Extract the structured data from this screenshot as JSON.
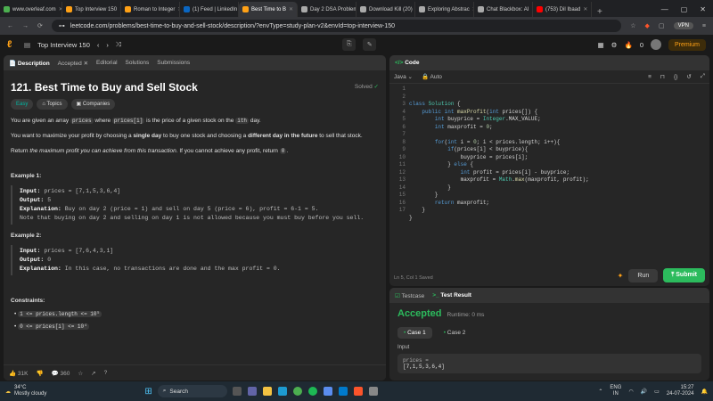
{
  "browser": {
    "tabs": [
      {
        "label": "www.overleaf.com",
        "color": "#4caf50"
      },
      {
        "label": "Top Interview 150",
        "color": "#ffa116"
      },
      {
        "label": "Roman to Integer",
        "color": "#ffa116"
      },
      {
        "label": "(1) Feed | LinkedIn",
        "color": "#0a66c2"
      },
      {
        "label": "Best Time to B",
        "color": "#ffa116",
        "active": true
      },
      {
        "label": "Day 2 DSA Problem",
        "color": "#aaaaaa"
      },
      {
        "label": "Download Kill (20)",
        "color": "#aaaaaa"
      },
      {
        "label": "Exploring Abstrac",
        "color": "#aaaaaa"
      },
      {
        "label": "Chat Blackbox: AI",
        "color": "#aaaaaa"
      },
      {
        "label": "(753) Dil Ibaad",
        "color": "#ff0000"
      }
    ],
    "url": "leetcode.com/problems/best-time-to-buy-and-sell-stock/description/?envType=study-plan-v2&envId=top-interview-150",
    "vpn": "VPN"
  },
  "lcnav": {
    "list_title": "Top Interview 150",
    "coins": "0",
    "premium": "Premium"
  },
  "left_tabs": [
    "Description",
    "Accepted",
    "Editorial",
    "Solutions",
    "Submissions"
  ],
  "problem": {
    "title": "121. Best Time to Buy and Sell Stock",
    "solved": "Solved",
    "difficulty": "Easy",
    "topics": "Topics",
    "companies": "Companies",
    "p1_a": "You are given an array ",
    "p1_code1": "prices",
    "p1_b": " where ",
    "p1_code2": "prices[i]",
    "p1_c": " is the price of a given stock on the ",
    "p1_sup": "ith",
    "p1_d": " day.",
    "p2_a": "You want to maximize your profit by choosing a ",
    "p2_b1": "single day",
    "p2_c": " to buy one stock and choosing a ",
    "p2_b2": "different day in the future",
    "p2_d": " to sell that stock.",
    "p3_a": "Return ",
    "p3_i": "the maximum profit you can achieve from this transaction",
    "p3_b": ". If you cannot achieve any profit, return ",
    "p3_code": "0",
    "p3_c": ".",
    "ex1_head": "Example 1:",
    "ex1_input": "prices = [7,1,5,3,6,4]",
    "ex1_output": "5",
    "ex1_expl": "Buy on day 2 (price = 1) and sell on day 5 (price = 6), profit = 6-1 = 5.",
    "ex1_note": "Note that buying on day 2 and selling on day 1 is not allowed because you must buy before you sell.",
    "ex2_head": "Example 2:",
    "ex2_input": "prices = [7,6,4,3,1]",
    "ex2_output": "0",
    "ex2_expl": "In this case, no transactions are done and the max profit = 0.",
    "constraints_head": "Constraints:",
    "c1": "1 <= prices.length <= 10⁵",
    "c2": "0 <= prices[i] <= 10⁴",
    "label_input": "Input:",
    "label_output": "Output:",
    "label_expl": "Explanation:"
  },
  "footer": {
    "likes": "31K",
    "comments": "360"
  },
  "editor": {
    "tab": "Code",
    "lang": "Java",
    "mode": "Auto",
    "status": "Ln 5, Col 1   Saved",
    "run": "Run",
    "submit": "Submit"
  },
  "result": {
    "tab1": "Testcase",
    "tab2": "Test Result",
    "verdict": "Accepted",
    "runtime": "Runtime: 0 ms",
    "case1": "Case 1",
    "case2": "Case 2",
    "input_label": "Input",
    "input_var": "prices =",
    "input_val": "[7,1,5,3,6,4]"
  },
  "taskbar": {
    "temp": "34°C",
    "weather": "Mostly cloudy",
    "search": "Search",
    "lang1": "ENG",
    "lang2": "IN",
    "time": "15:27",
    "date": "24-07-2024"
  }
}
